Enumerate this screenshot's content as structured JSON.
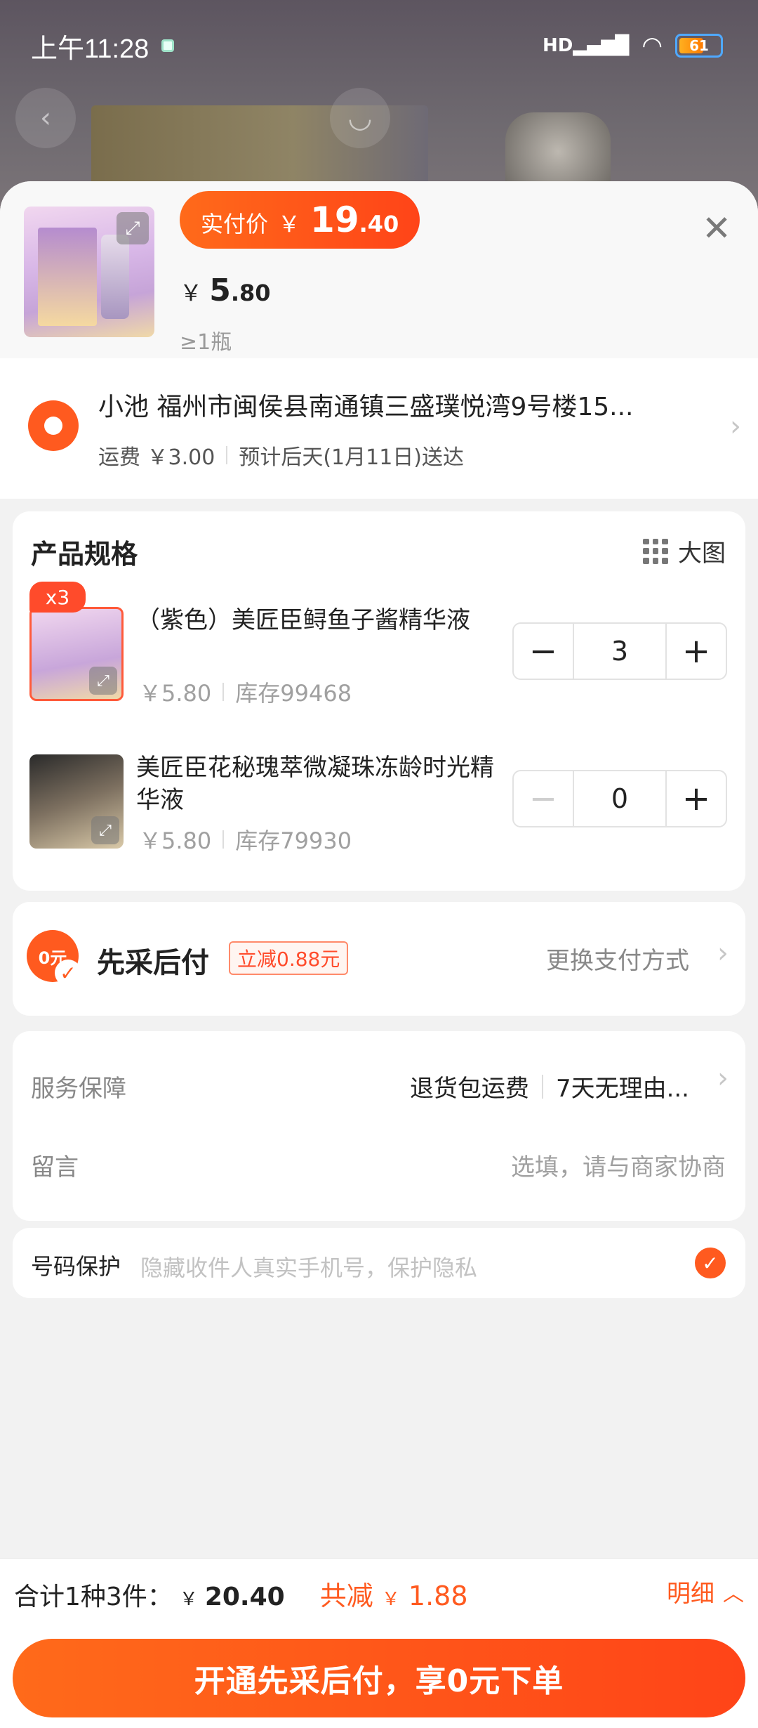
{
  "status_bar": {
    "time": "上午11:28",
    "signal_label": "HD",
    "battery": "61",
    "battery_level": 0.61
  },
  "header": {
    "pay_price_label": "实付价",
    "currency": "￥",
    "pay_price_int": "19",
    "pay_price_dec": ".40",
    "unit_price_int": "5",
    "unit_price_dec": ".80",
    "min_qty": "≥1瓶"
  },
  "address": {
    "line": "小池 福州市闽侯县南通镇三盛璞悦湾9号楼15...",
    "shipping": "运费 ￥3.00",
    "eta": "预计后天(1月11日)送达"
  },
  "spec": {
    "title": "产品规格",
    "big_view": "大图",
    "items": [
      {
        "badge": "x3",
        "name": "（紫色）美匠臣鲟鱼子酱精华液",
        "price": "￥5.80",
        "stock": "库存99468",
        "qty": "3"
      },
      {
        "name": "美匠臣花秘瑰萃微凝珠冻龄时光精华液",
        "price": "￥5.80",
        "stock": "库存79930",
        "qty": "0"
      }
    ]
  },
  "payment": {
    "title": "先采后付",
    "badge": "立减0.88元",
    "change": "更换支付方式",
    "icon_text": "0元"
  },
  "service": {
    "label": "服务保障",
    "value1": "退货包运费",
    "value2": "7天无理由...",
    "note_label": "留言",
    "note_placeholder": "选填，请与商家协商"
  },
  "protect": {
    "label": "号码保护",
    "hint": "隐藏收件人真实手机号，保护隐私"
  },
  "footer": {
    "total_label": "合计1种3件：",
    "total_amount": "20.40",
    "reduce_label": "共减",
    "reduce_amount": "1.88",
    "detail": "明细",
    "cta": "开通先采后付，享0元下单"
  },
  "colors": {
    "accent": "#ff5a1f",
    "accent_dark": "#ff4418"
  }
}
